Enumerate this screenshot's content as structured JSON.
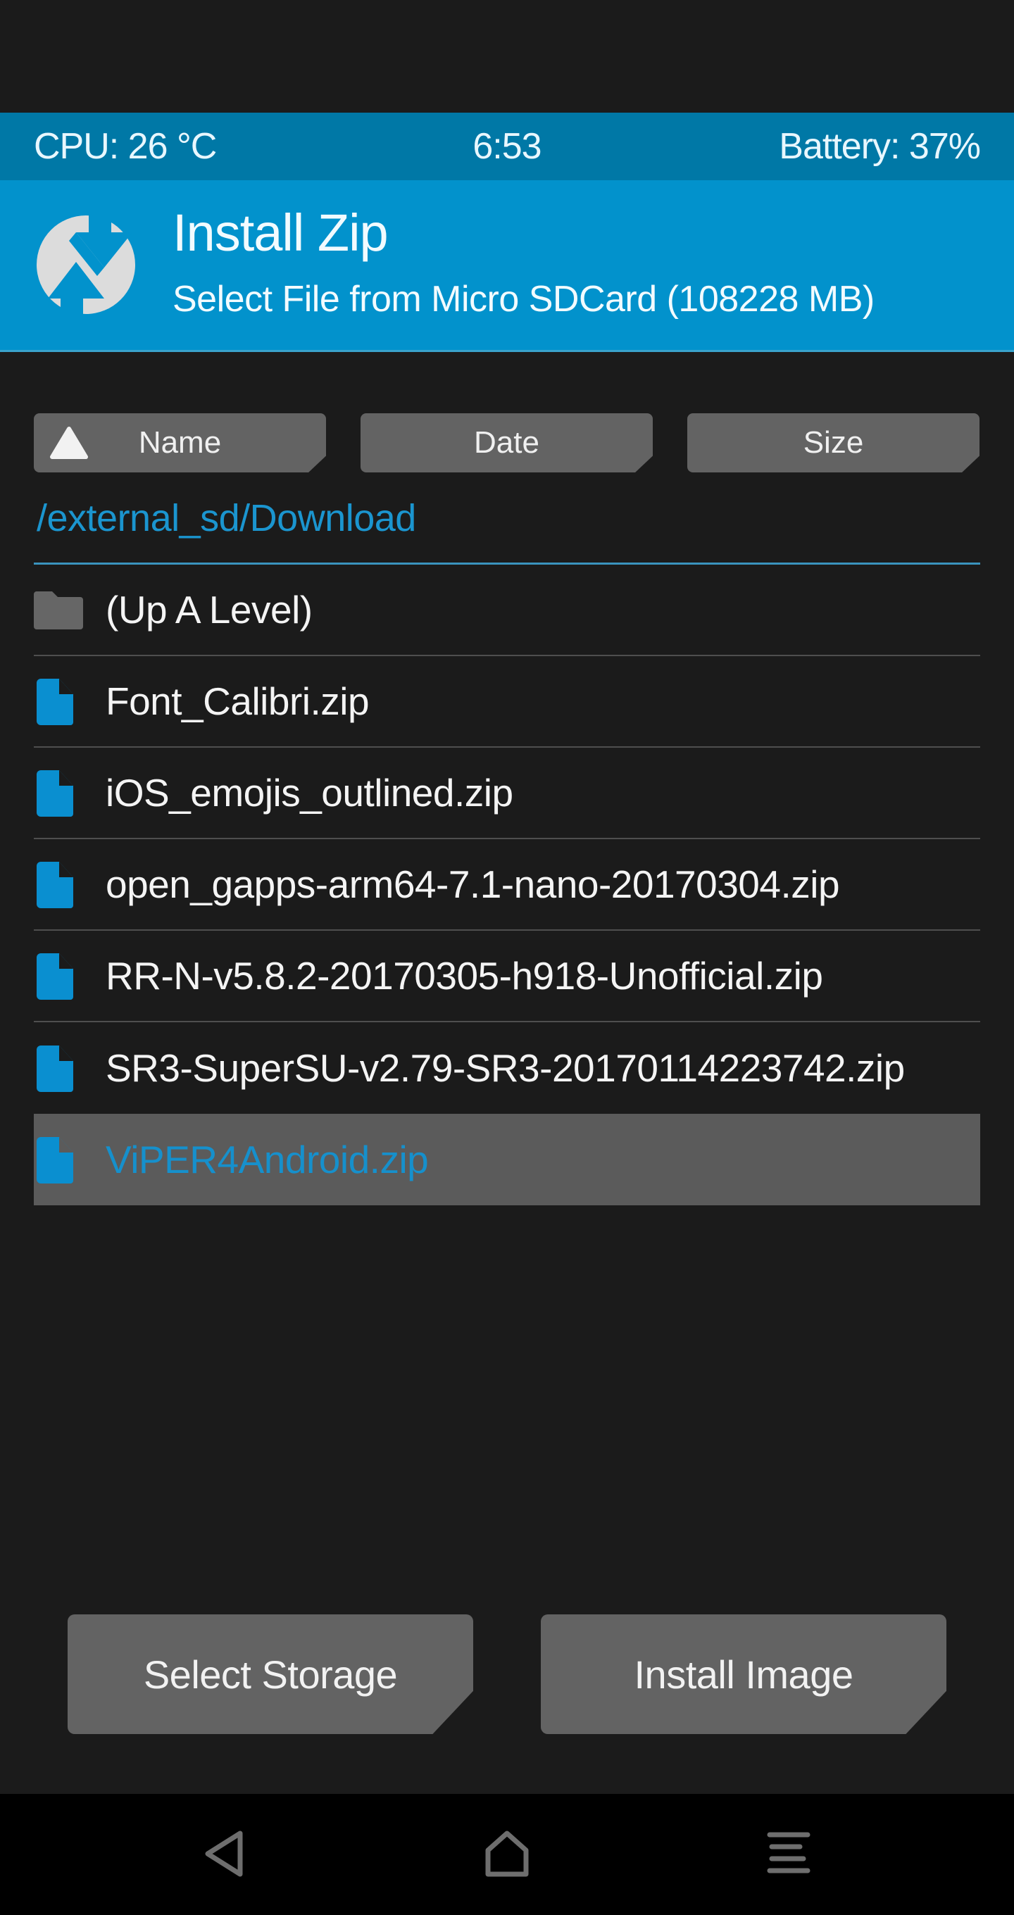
{
  "status_bar": {
    "cpu": "CPU: 26 °C",
    "time": "6:53",
    "battery": "Battery: 37%"
  },
  "header": {
    "logo_icon": "twrp-logo-icon",
    "title": "Install Zip",
    "subtitle": "Select File from Micro SDCard (108228 MB)"
  },
  "sort_buttons": [
    {
      "label": "Name",
      "active": true,
      "direction": "ascending"
    },
    {
      "label": "Date",
      "active": false
    },
    {
      "label": "Size",
      "active": false
    }
  ],
  "current_path": "/external_sd/Download",
  "files": [
    {
      "name": "(Up A Level)",
      "type": "folder",
      "selected": false
    },
    {
      "name": "Font_Calibri.zip",
      "type": "file",
      "selected": false
    },
    {
      "name": "iOS_emojis_outlined.zip",
      "type": "file",
      "selected": false
    },
    {
      "name": "open_gapps-arm64-7.1-nano-20170304.zip",
      "type": "file",
      "selected": false
    },
    {
      "name": "RR-N-v5.8.2-20170305-h918-Unofficial.zip",
      "type": "file",
      "selected": false
    },
    {
      "name": "SR3-SuperSU-v2.79-SR3-20170114223742.zip",
      "type": "file",
      "selected": false
    },
    {
      "name": "ViPER4Android.zip",
      "type": "file",
      "selected": true
    }
  ],
  "actions": {
    "select_storage": "Select Storage",
    "install_image": "Install Image"
  },
  "navbar": {
    "back_icon": "back-icon",
    "home_icon": "home-icon",
    "menu_icon": "menu-icon"
  },
  "colors": {
    "status_bar": "#0078a6",
    "header": "#0292cc",
    "accent": "#1b95cf",
    "background": "#1b1b1b",
    "button": "#636363",
    "selected_row": "#5b5b5b"
  }
}
